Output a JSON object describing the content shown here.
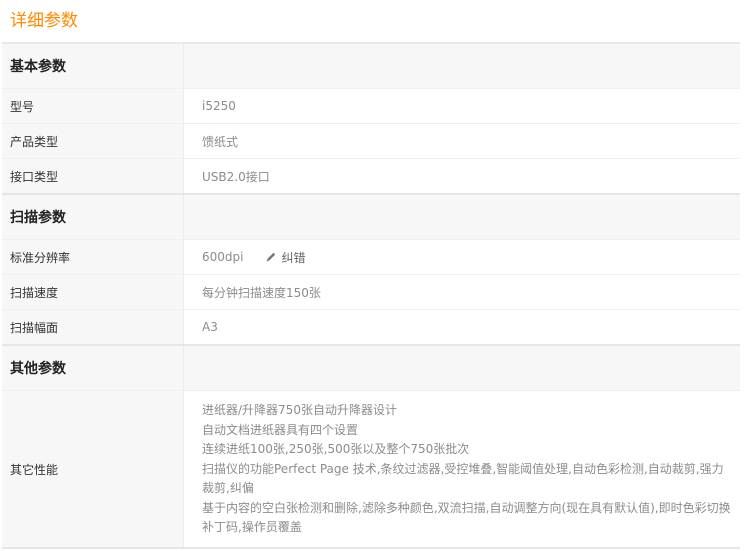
{
  "page": {
    "title": "详细参数"
  },
  "sections": [
    {
      "title": "基本参数",
      "rows": [
        {
          "label": "型号",
          "value": "i5250"
        },
        {
          "label": "产品类型",
          "value": "馈纸式"
        },
        {
          "label": "接口类型",
          "value": "USB2.0接口"
        }
      ]
    },
    {
      "title": "扫描参数",
      "rows": [
        {
          "label": "标准分辨率",
          "value": "600dpi",
          "correct_label": "纠错"
        },
        {
          "label": "扫描速度",
          "value": "每分钟扫描速度150张"
        },
        {
          "label": "扫描幅面",
          "value": "A3"
        }
      ]
    },
    {
      "title": "其他参数",
      "rows": [
        {
          "label": "其它性能",
          "lines": [
            "进纸器/升降器750张自动升降器设计",
            "自动文档进纸器具有四个设置",
            "连续进纸100张,250张,500张以及整个750张批次",
            "扫描仪的功能Perfect Page 技术,条纹过滤器,受控堆叠,智能阈值处理,自动色彩检测,自动裁剪,强力裁剪,纠偏",
            "基于内容的空白张检测和删除,滤除多种颜色,双流扫描,自动调整方向(现在具有默认值),即时色彩切换补丁码,操作员覆盖"
          ]
        }
      ]
    }
  ],
  "colors": {
    "accent": "#ff8a00",
    "label_bg": "#f7f7f7",
    "value_text": "#8c8c8c"
  },
  "icons": {
    "correct": "pencil-icon"
  }
}
